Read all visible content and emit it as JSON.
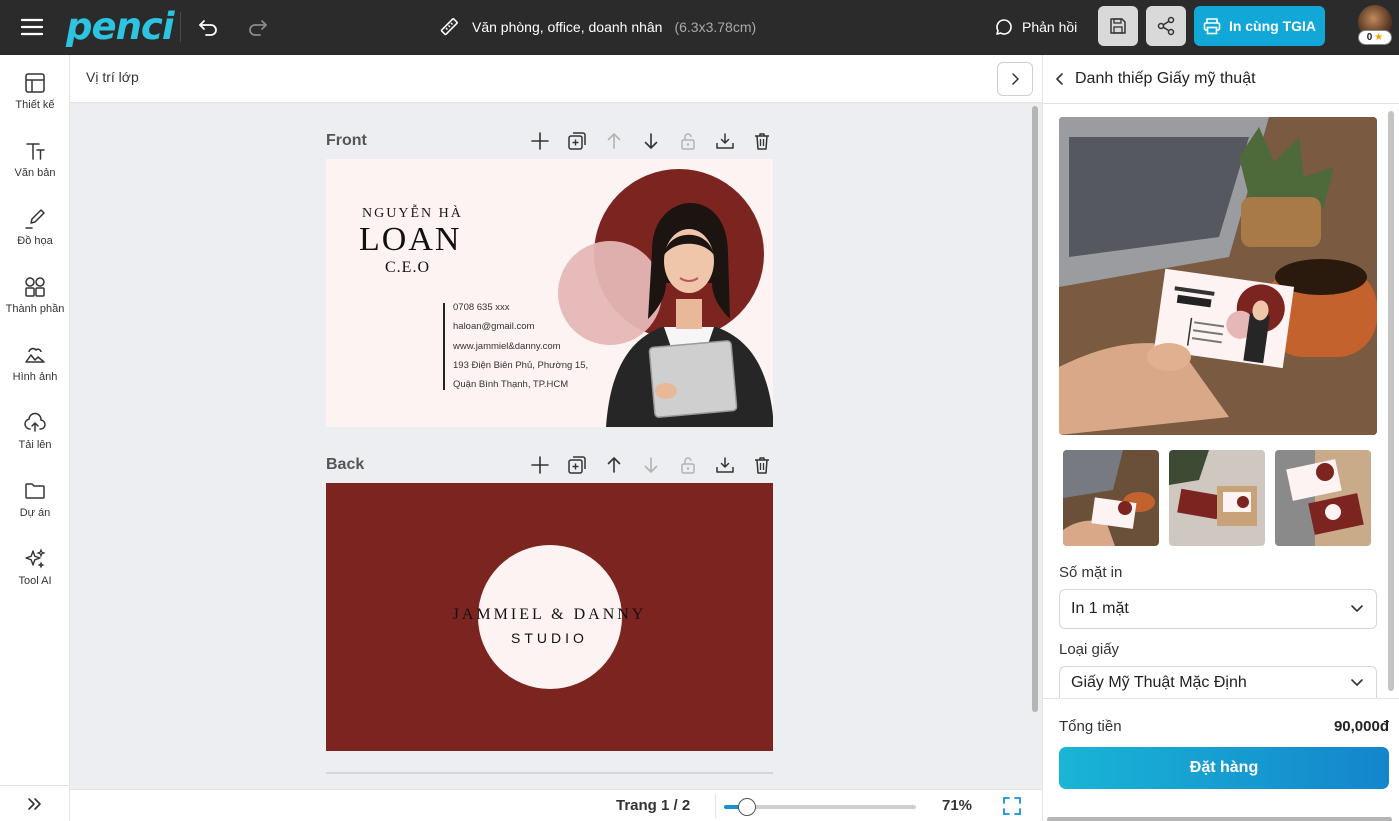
{
  "app": {
    "logo": "penci"
  },
  "document": {
    "title": "Văn phòng, office, doanh nhân",
    "size": "(6.3x3.78cm)"
  },
  "topbar": {
    "feedback_label": "Phản hồi",
    "print_label": "In cùng TGIA",
    "coins": "0"
  },
  "sidebar": {
    "items": [
      {
        "label": "Thiết kế",
        "icon": "layout-icon"
      },
      {
        "label": "Văn bản",
        "icon": "text-icon"
      },
      {
        "label": "Đồ họa",
        "icon": "pen-icon"
      },
      {
        "label": "Thành phần",
        "icon": "components-icon"
      },
      {
        "label": "Hình ảnh",
        "icon": "image-icon"
      },
      {
        "label": "Tải lên",
        "icon": "upload-icon"
      },
      {
        "label": "Dự án",
        "icon": "folder-icon"
      },
      {
        "label": "Tool AI",
        "icon": "sparkle-icon"
      }
    ]
  },
  "layerbar": {
    "label": "Vị trí lớp"
  },
  "pages": [
    {
      "label": "Front"
    },
    {
      "label": "Back"
    }
  ],
  "front_card": {
    "first_name": "NGUYỄN HÀ",
    "last_name": "LOAN",
    "title": "C.E.O",
    "contacts": [
      "0708 635 xxx",
      "haloan@gmail.com",
      "www.jammiel&danny.com",
      "193 Điện Biên Phủ, Phường 15,",
      "Quận Bình Thạnh, TP.HCM"
    ],
    "colors": {
      "background": "#fdf3f2",
      "accent": "#7c2420",
      "pink": "#e5b7b6"
    }
  },
  "back_card": {
    "line1": "JAMMIEL & DANNY",
    "line2": "STUDIO",
    "colors": {
      "background": "#7c2420",
      "circle": "#fdf3f2"
    }
  },
  "bottombar": {
    "page_indicator": "Trang 1 / 2",
    "zoom_label": "71%",
    "zoom_fraction": 0.12
  },
  "right_panel": {
    "title": "Danh thiếp Giấy mỹ thuật",
    "sides_label": "Số mặt in",
    "sides_value": "In 1 mặt",
    "paper_label": "Loại giấy",
    "paper_value": "Giấy Mỹ Thuật Mặc Định",
    "total_label": "Tổng tiền",
    "total_value": "90,000đ",
    "order_label": "Đặt hàng"
  }
}
